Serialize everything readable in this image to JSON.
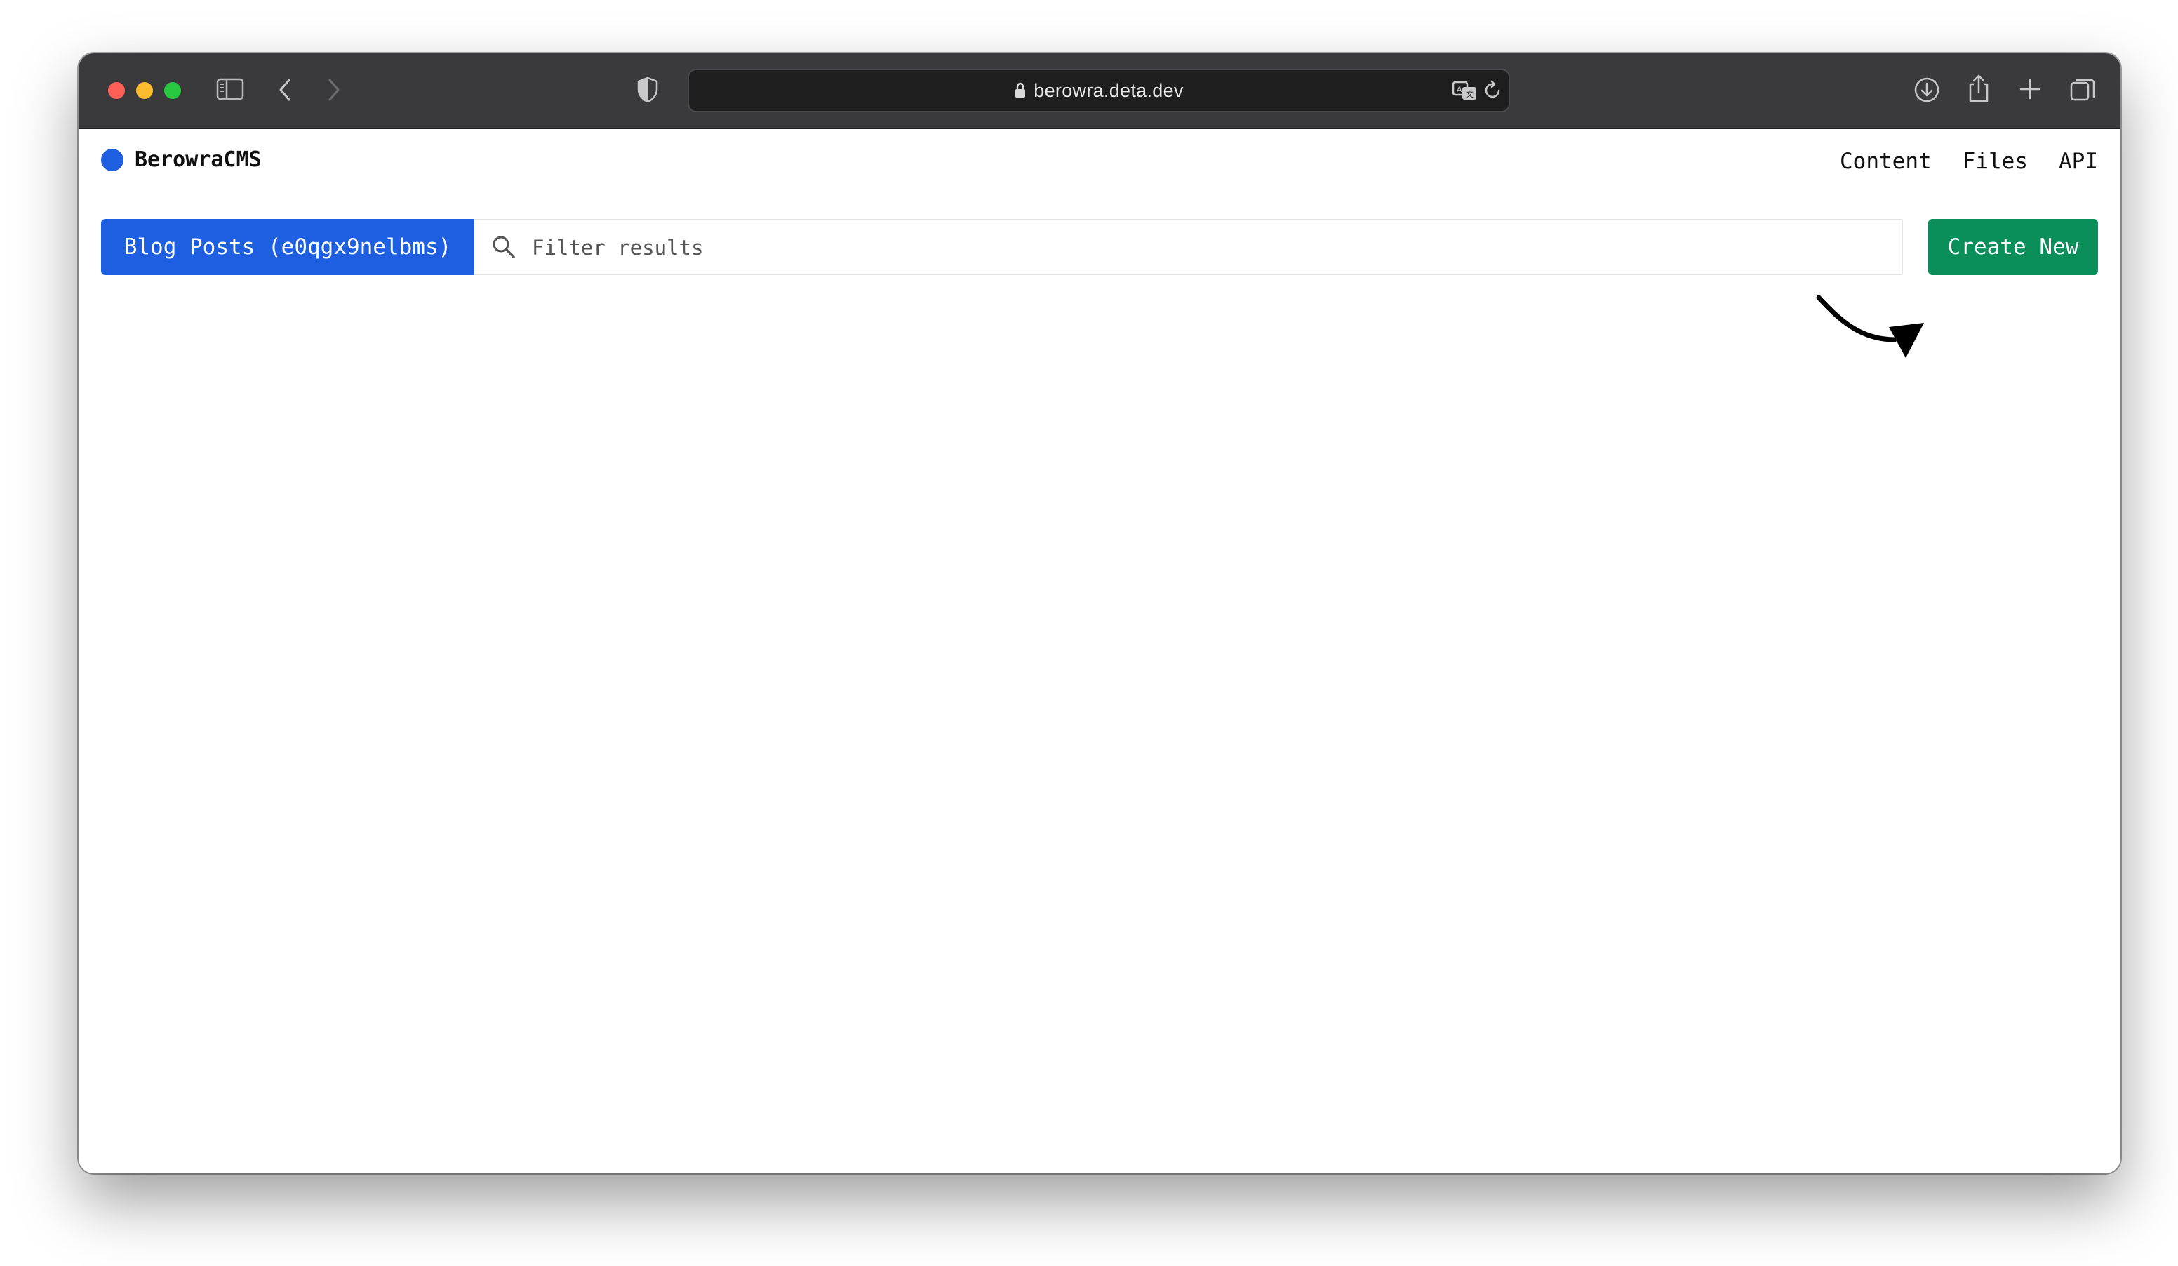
{
  "browser": {
    "url": "berowra.deta.dev"
  },
  "app": {
    "brand_name": "BerowraCMS",
    "nav": [
      "Content",
      "Files",
      "API"
    ]
  },
  "toolbar": {
    "collection_label": "Blog Posts (e0qgx9nelbms)",
    "filter_placeholder": "Filter results",
    "create_label": "Create New"
  },
  "colors": {
    "brand_dot": "#1d5fe0",
    "collection_button": "#1d5fe0",
    "create_button": "#0a8f5b"
  }
}
